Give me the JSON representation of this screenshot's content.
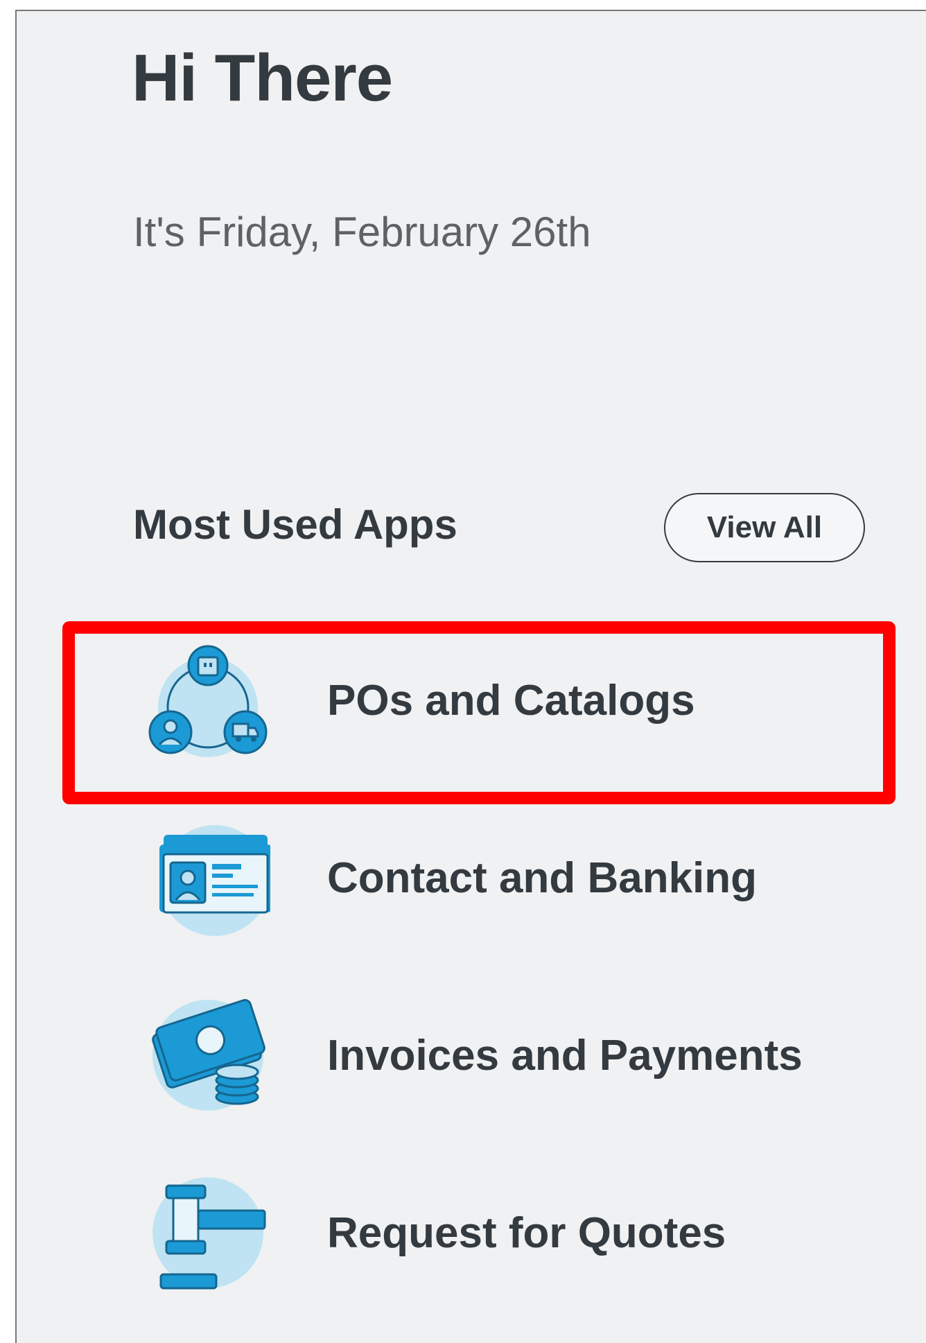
{
  "header": {
    "greeting": "Hi There",
    "date": "It's Friday, February 26th"
  },
  "apps_section": {
    "title": "Most Used Apps",
    "view_all_label": "View All",
    "items": [
      {
        "label": "POs and Catalogs",
        "icon": "pos-catalogs-icon"
      },
      {
        "label": "Contact and Banking",
        "icon": "contact-card-icon"
      },
      {
        "label": "Invoices and Payments",
        "icon": "money-coins-icon"
      },
      {
        "label": "Request for Quotes",
        "icon": "gavel-icon"
      }
    ]
  },
  "colors": {
    "icon_primary": "#1b9ad6",
    "icon_light": "#bfe3f3",
    "icon_stroke": "#15668f",
    "highlight": "#ff0000",
    "text": "#333a40"
  }
}
